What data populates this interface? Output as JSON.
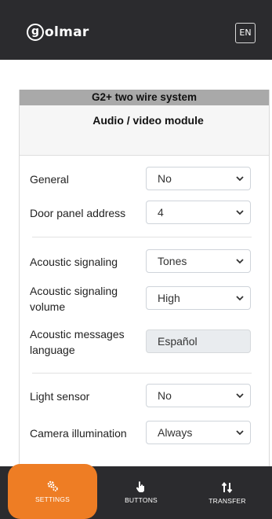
{
  "header": {
    "logo_text": "olmar",
    "logo_letter": "g",
    "lang_button": "EN"
  },
  "card": {
    "system_title": "G2+ two wire system",
    "module_title": "Audio / video module"
  },
  "settings": [
    {
      "label": "General",
      "value": "No",
      "editable": true
    },
    {
      "label": "Door panel address",
      "value": "4",
      "editable": true
    },
    {
      "label": "Acoustic signaling",
      "value": "Tones",
      "editable": true
    },
    {
      "label": "Acoustic signaling volume",
      "value": "High",
      "editable": true
    },
    {
      "label": "Acoustic messages language",
      "value": "Español",
      "editable": false
    },
    {
      "label": "Light sensor",
      "value": "No",
      "editable": true
    },
    {
      "label": "Camera illumination",
      "value": "Always",
      "editable": true
    }
  ],
  "bottom_nav": [
    {
      "label": "SETTINGS",
      "icon": "gears-icon",
      "active": true
    },
    {
      "label": "BUTTONS",
      "icon": "hand-pointer-icon",
      "active": false
    },
    {
      "label": "TRANSFER",
      "icon": "transfer-arrows-icon",
      "active": false
    }
  ],
  "colors": {
    "topbar": "#2b2b2e",
    "accent": "#ee7d24",
    "card_header": "#a9a9a9"
  }
}
